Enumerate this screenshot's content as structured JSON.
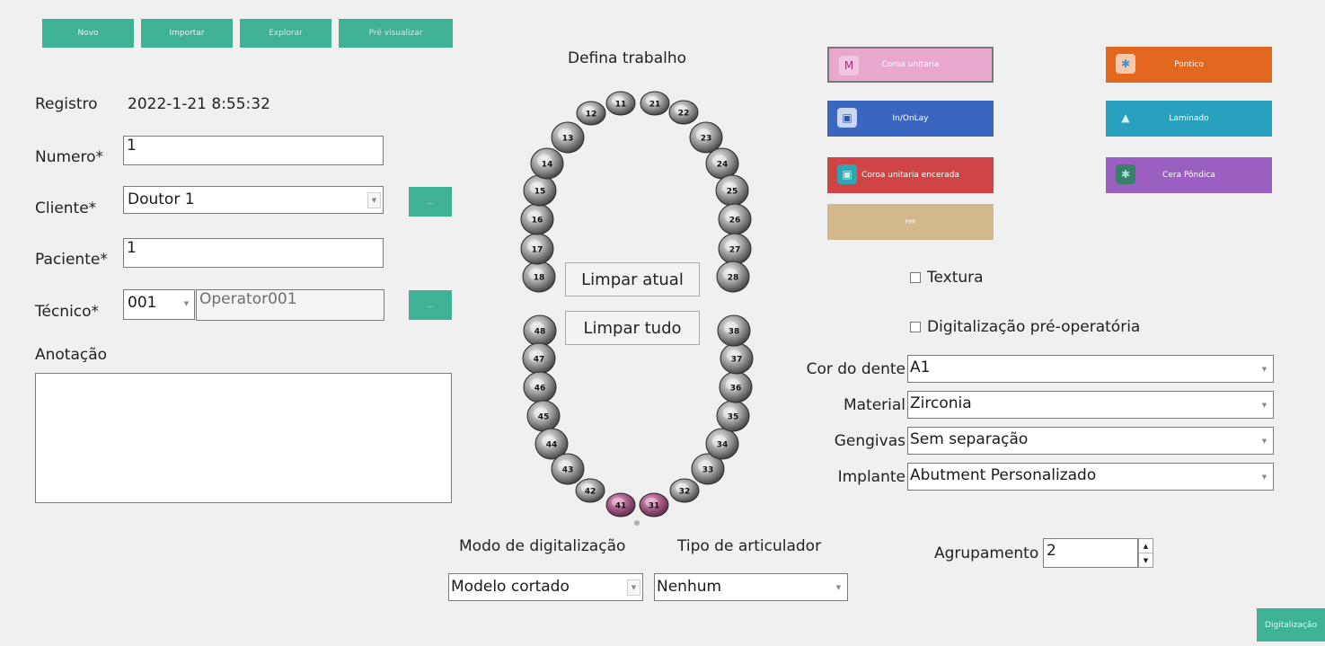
{
  "toolbar": {
    "new_label": "Novo",
    "import_label": "Importar",
    "explore_label": "Explorar",
    "preview_label": "Pré visualizar"
  },
  "form": {
    "registro_label": "Registro",
    "registro_value": "2022-1-21 8:55:32",
    "numero_label": "Numero*",
    "numero_value": "1",
    "cliente_label": "Cliente*",
    "cliente_value": "Doutor 1",
    "cliente_more": "...",
    "paciente_label": "Paciente*",
    "paciente_value": "1",
    "tecnico_label": "Técnico*",
    "tecnico_code": "001",
    "tecnico_name": "Operator001",
    "tecnico_more": "...",
    "anotacao_label": "Anotação",
    "anotacao_value": ""
  },
  "dental_chart": {
    "title": "Defina trabalho",
    "clear_current_label": "Limpar atual",
    "clear_all_label": "Limpar tudo",
    "selected_teeth": [
      "41",
      "31"
    ],
    "upper_teeth": [
      "18",
      "17",
      "16",
      "15",
      "14",
      "13",
      "12",
      "11",
      "21",
      "22",
      "23",
      "24",
      "25",
      "26",
      "27",
      "28"
    ],
    "lower_teeth": [
      "48",
      "47",
      "46",
      "45",
      "44",
      "43",
      "42",
      "41",
      "31",
      "32",
      "33",
      "34",
      "35",
      "36",
      "37",
      "38"
    ]
  },
  "work_types": [
    {
      "label": "Coroa unitaria",
      "color": "#e9a9cf",
      "icon": "crown-icon",
      "selected": true
    },
    {
      "label": "Pontico",
      "color": "#e2681f",
      "icon": "pontic-icon"
    },
    {
      "label": "In/OnLay",
      "color": "#3b66c0",
      "icon": "inlay-icon"
    },
    {
      "label": "Laminado",
      "color": "#2aa0bf",
      "icon": "veneer-icon"
    },
    {
      "label": "Coroa unitaria encerada",
      "color": "#cf4445",
      "icon": "wax-crown-icon"
    },
    {
      "label": "Cera Pôndica",
      "color": "#9a5fc0",
      "icon": "wax-pontic-icon"
    },
    {
      "label": "PPR",
      "color": "#d2b98b",
      "icon": ""
    }
  ],
  "options": {
    "textura_label": "Textura",
    "preop_label": "Digitalização pré-operatória",
    "cor_label": "Cor do dente",
    "cor_value": "A1",
    "material_label": "Material",
    "material_value": "Zirconia",
    "gengivas_label": "Gengivas",
    "gengivas_value": "Sem separação",
    "implante_label": "Implante",
    "implante_value": "Abutment Personalizado"
  },
  "scan": {
    "modo_label": "Modo de digitalização",
    "modo_value": "Modelo cortado",
    "articulador_label": "Tipo de articulador",
    "articulador_value": "Nenhum",
    "agrupamento_label": "Agrupamento",
    "agrupamento_value": "2",
    "scan_button": "Digitalização"
  }
}
